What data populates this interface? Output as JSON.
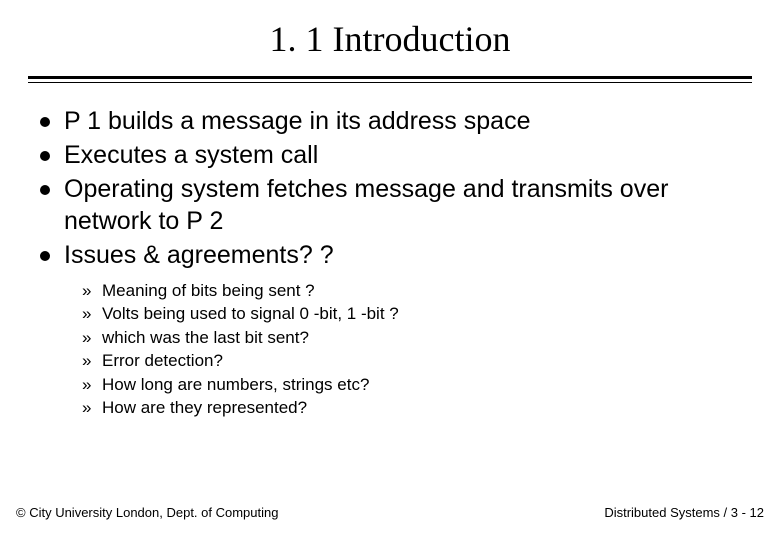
{
  "title": "1. 1 Introduction",
  "bullets": [
    "P 1 builds a message in its address space",
    "Executes a system call",
    "Operating system fetches message  and transmits over network to P 2",
    "Issues & agreements? ?"
  ],
  "subbullets": [
    "Meaning of bits being sent ?",
    "Volts being used to signal 0 -bit, 1 -bit ?",
    "which was the last bit sent?",
    "Error detection?",
    "How long are numbers, strings etc?",
    "How are they represented?"
  ],
  "footer": {
    "left": "© City University London, Dept. of Computing",
    "right": "Distributed Systems / 3 - 12"
  }
}
